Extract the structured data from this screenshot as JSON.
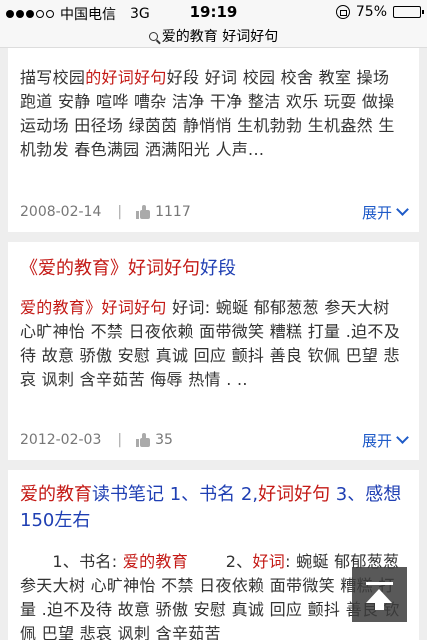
{
  "status_bar": {
    "carrier": "中国电信",
    "network": "3G",
    "time": "19:19",
    "battery": "75%",
    "battery_level": 0.75
  },
  "url_bar": {
    "text": "爱的教育 好词好句"
  },
  "results": [
    {
      "snippet": [
        {
          "t": "描写校园",
          "h": false
        },
        {
          "t": "的好词好句",
          "h": true
        },
        {
          "t": "好段 好词 校园 校舍 教室 操场 跑道 安静 喧哗 嘈杂 洁净 干净 整洁 欢乐 玩耍 做操 运动场 田径场 绿茵茵 静悄悄 生机勃勃 生机盎然 生机勃发 春色满园 洒满阳光 人声...",
          "h": false
        }
      ],
      "date": "2008-02-14",
      "likes": "1117",
      "expand": "展开"
    },
    {
      "title": [
        {
          "t": "《爱的教育》",
          "c": "red"
        },
        {
          "t": "好词好句",
          "c": "red"
        },
        {
          "t": "好段",
          "c": "blue"
        }
      ],
      "snippet": [
        {
          "t": "爱的教育》",
          "h": true
        },
        {
          "t": "好词好句",
          "h": true
        },
        {
          "t": " 好词: 蜿蜒 郁郁葱葱 参天大树 心旷神怡 不禁 日夜依赖 面带微笑 糟糕 打量 .迫不及待 故意 骄傲 安慰 真诚 回应 颤抖 善良 钦佩 巴望 悲哀 讽刺 含辛茹苦 侮辱 热情 . ..",
          "h": false
        }
      ],
      "date": "2012-02-03",
      "likes": "35",
      "expand": "展开"
    },
    {
      "title": [
        {
          "t": "爱的教育",
          "c": "red"
        },
        {
          "t": "读书笔记 1、书名 2,",
          "c": "blue"
        },
        {
          "t": "好词好句",
          "c": "red"
        },
        {
          "t": " 3、感想150左右",
          "c": "blue"
        }
      ],
      "snippet": [
        {
          "t": "      1、书名: ",
          "h": false
        },
        {
          "t": "爱的教育",
          "h": true
        },
        {
          "t": "       2、",
          "h": false
        },
        {
          "t": "好词",
          "h": true
        },
        {
          "t": ": 蜿蜒 郁郁葱葱 参天大树 心旷神怡 不禁 日夜依赖 面带微笑 糟糕 打量 .迫不及待 故意 骄傲 安慰 真诚 回应 颤抖 善良 钦佩 巴望 悲哀 讽刺 含辛茹苦",
          "h": false
        }
      ]
    }
  ],
  "back_to_top_icon": "back-to-top-icon"
}
